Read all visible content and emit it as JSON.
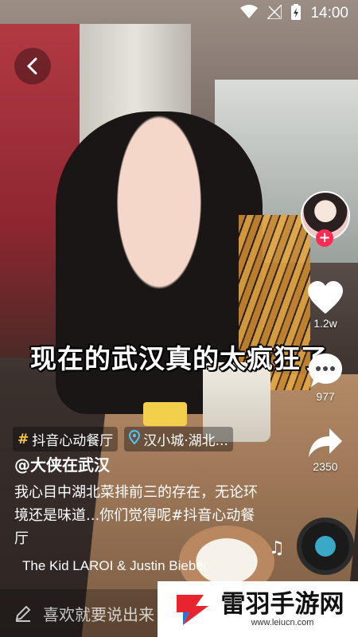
{
  "status_bar": {
    "time": "14:00"
  },
  "video": {
    "caption": "现在的武汉真的太疯狂了"
  },
  "actions": {
    "like_count": "1.2w",
    "comment_count": "977",
    "share_count": "2350"
  },
  "post": {
    "tags": [
      {
        "label": "抖音心动餐厅"
      },
      {
        "label": "汉小城·湖北..."
      }
    ],
    "author": "@大侠在武汉",
    "description": "我心目中湖北菜排前三的存在，无论环境还是味道...你们觉得呢#抖音心动餐厅",
    "music": "The Kid LAROI & Justin Bieber"
  },
  "comment_bar": {
    "placeholder": "喜欢就要说出来"
  },
  "watermark": {
    "name": "雷羽手游网",
    "url": "www.leiucn.com"
  },
  "colors": {
    "accent": "#fe2c55",
    "tag_hash": "#f5c542",
    "location_pin": "#4fc3f7"
  }
}
